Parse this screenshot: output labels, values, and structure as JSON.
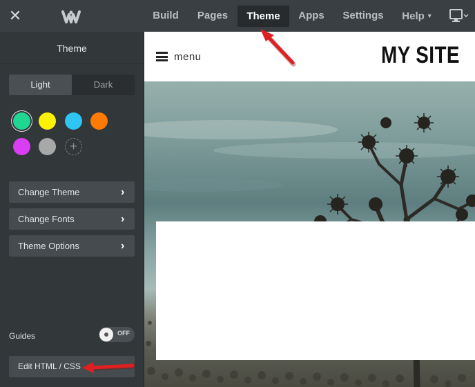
{
  "topbar": {
    "close_icon": "close-icon",
    "logo_icon": "weebly-w-logo",
    "nav": {
      "build": "Build",
      "pages": "Pages",
      "theme": "Theme",
      "apps": "Apps",
      "settings": "Settings",
      "help": "Help"
    },
    "device_icon": "monitor-icon"
  },
  "sidebar": {
    "title": "Theme",
    "mode": {
      "light": "Light",
      "dark": "Dark",
      "selected": "Light"
    },
    "swatches": [
      "#1fd693",
      "#fff200",
      "#2ec5f2",
      "#ff7a00",
      "#d93ef2",
      "#a8a8a8"
    ],
    "selected_swatch": "#1fd693",
    "buttons": {
      "change_theme": "Change Theme",
      "change_fonts": "Change Fonts",
      "theme_options": "Theme Options"
    },
    "guides": {
      "label": "Guides",
      "state": "OFF"
    },
    "edit_html": "Edit HTML / CSS"
  },
  "preview": {
    "menu_label": "menu",
    "site_title": "MY SITE"
  },
  "colors": {
    "topbar_bg": "#3a3f43",
    "sidebar_bg": "#32373a",
    "annotation_arrow": "#e02020"
  }
}
